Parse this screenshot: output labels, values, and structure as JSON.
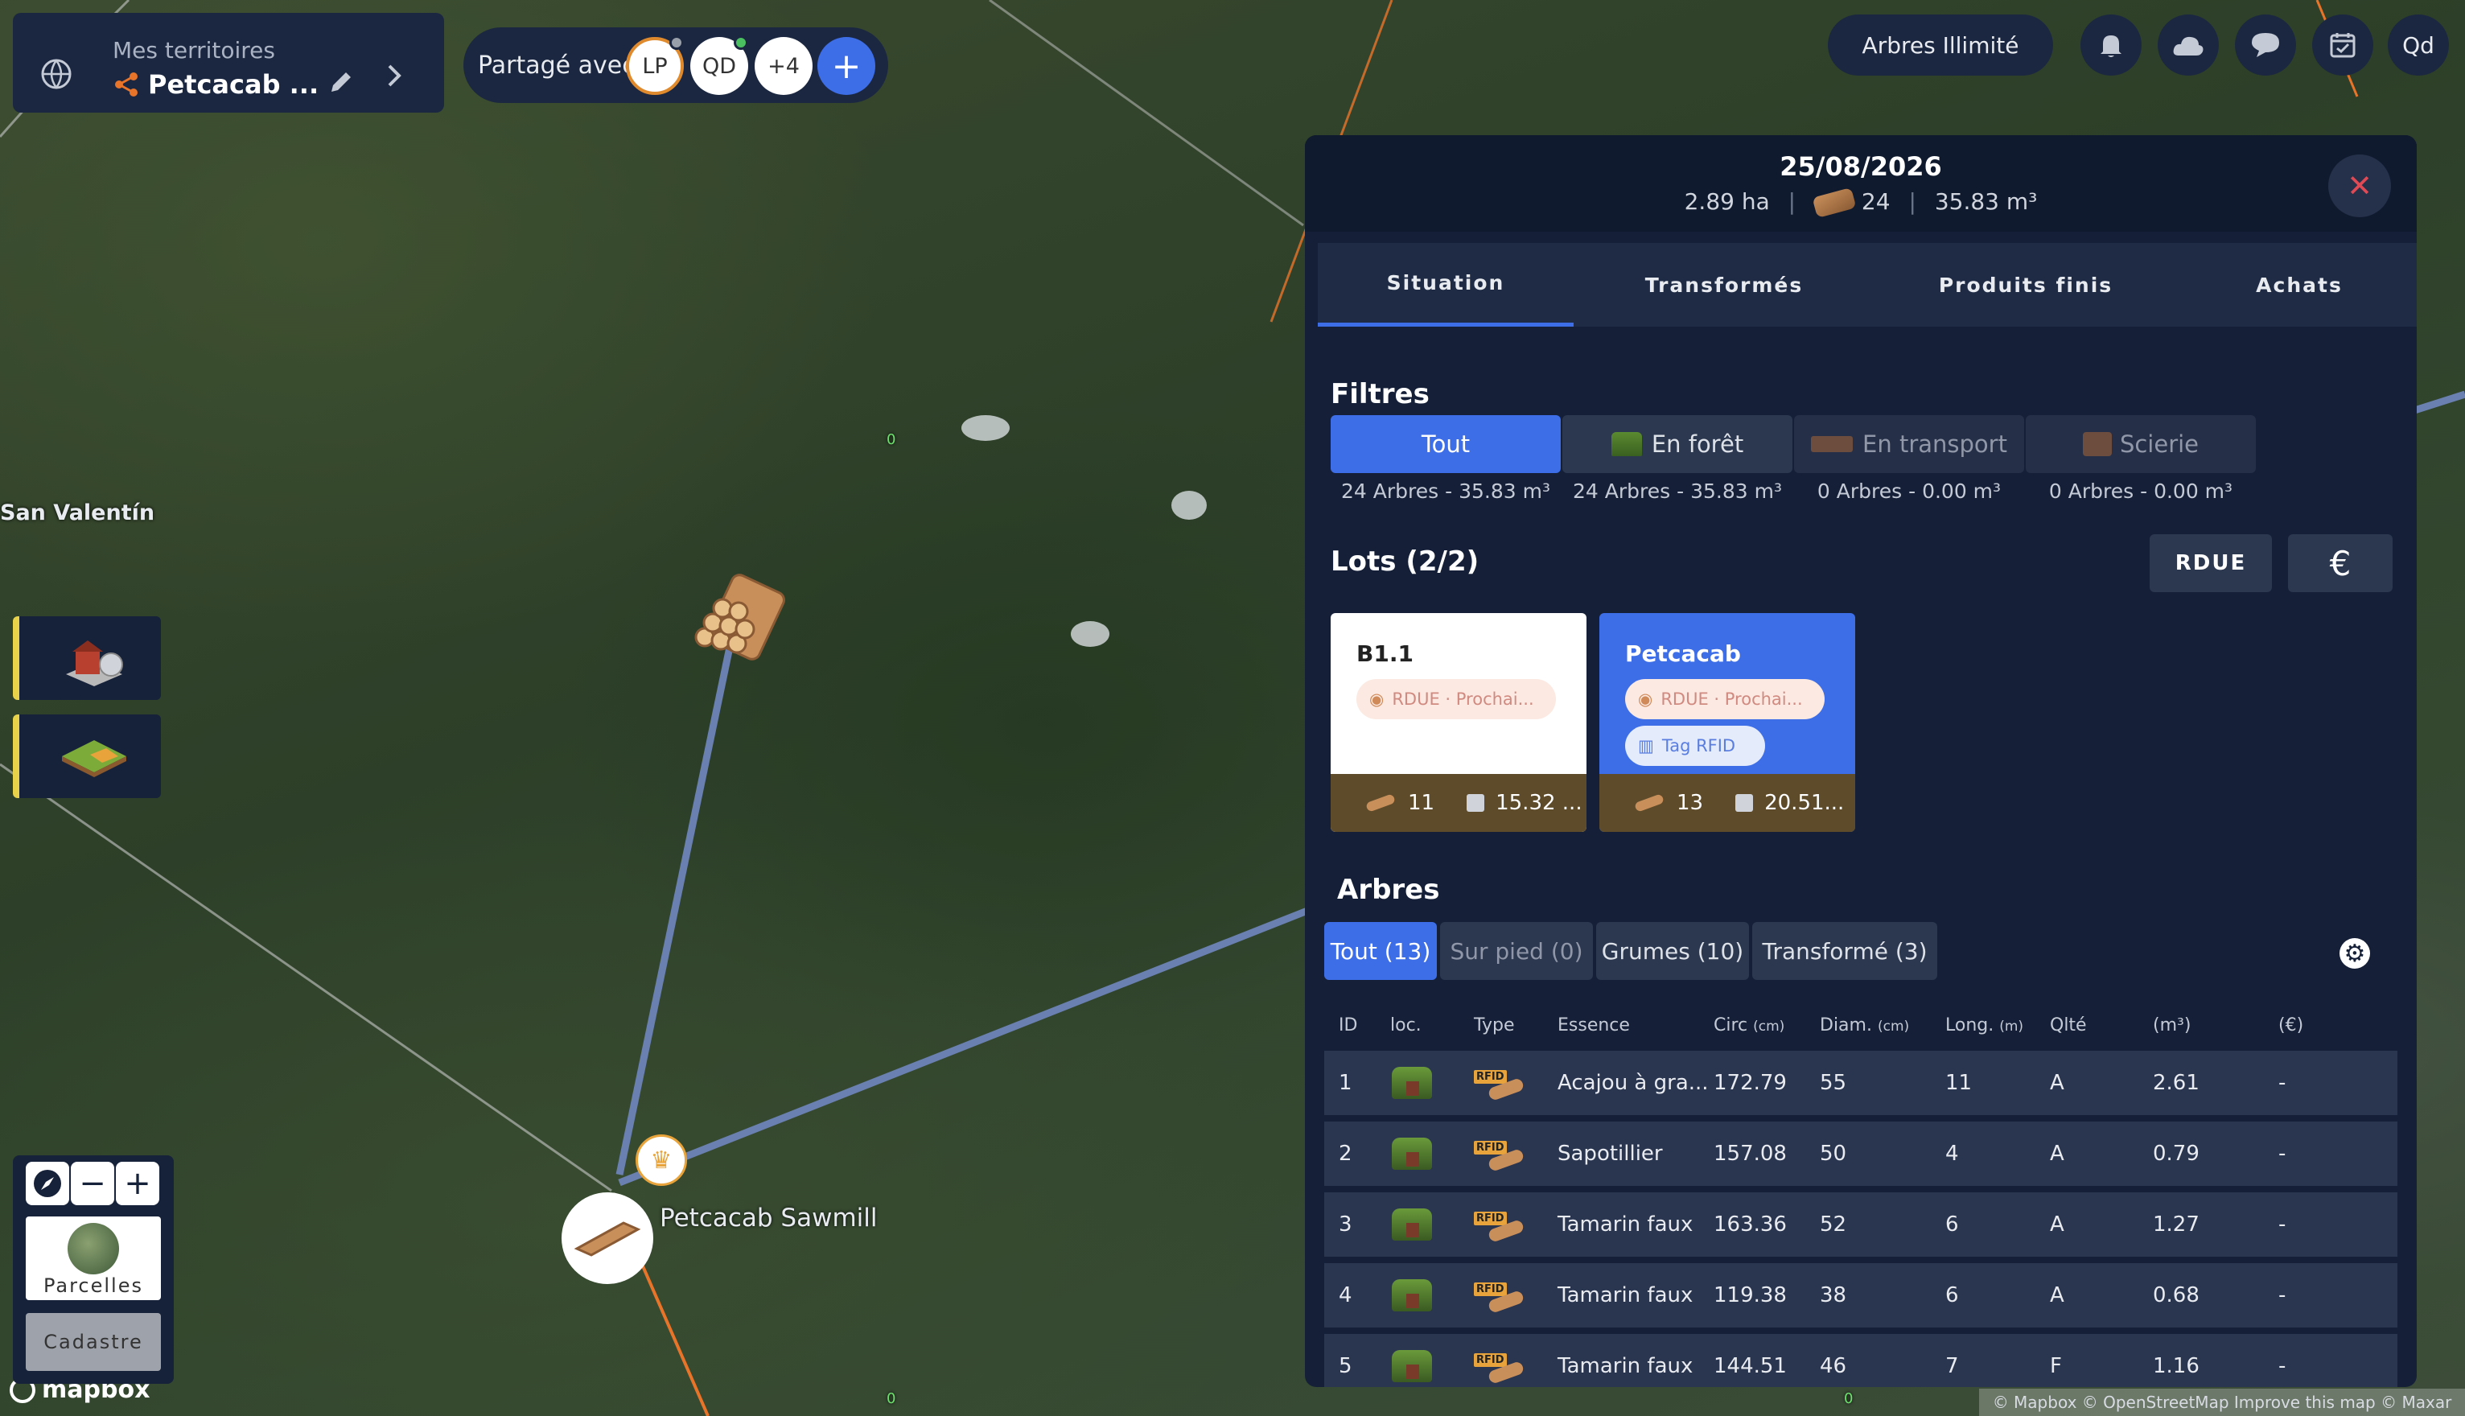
{
  "territory": {
    "label": "Mes territoires",
    "name": "Petcacab ..."
  },
  "share": {
    "label": "Partagé avec",
    "avatars": [
      "LP",
      "QD",
      "+4",
      "+"
    ]
  },
  "topbar": {
    "plan": "Arbres Illimité",
    "user": "Qd"
  },
  "map": {
    "place": "San Valentín",
    "sawmill": "Petcacab Sawmill",
    "zero1": "0",
    "zero2": "0",
    "zero3": "0",
    "logo": "mapbox",
    "attribution": "© Mapbox © OpenStreetMap Improve this map © Maxar"
  },
  "mapcontrols": {
    "parcelles": "Parcelles",
    "cadastre": "Cadastre"
  },
  "panel": {
    "date": "25/08/2026",
    "area": "2.89 ha",
    "count": "24",
    "volume": "35.83 m³",
    "tabs": [
      "Situation",
      "Transformés",
      "Produits finis",
      "Achats"
    ],
    "filters_title": "Filtres",
    "filters": [
      {
        "label": "Tout",
        "sub": "24 Arbres - 35.83 m³"
      },
      {
        "label": "En forêt",
        "sub": "24 Arbres - 35.83 m³"
      },
      {
        "label": "En transport",
        "sub": "0 Arbres - 0.00 m³"
      },
      {
        "label": "Scierie",
        "sub": "0 Arbres - 0.00 m³"
      }
    ],
    "lots_title": "Lots (2/2)",
    "rdue": "RDUE",
    "euro": "€",
    "lots": [
      {
        "name": "B1.1",
        "tag": "RDUE · Prochai...",
        "count": "11",
        "vol": "15.32 ..."
      },
      {
        "name": "Petcacab",
        "tag": "RDUE · Prochai...",
        "rfid": "Tag RFID",
        "count": "13",
        "vol": "20.51..."
      }
    ],
    "trees_title": "Arbres",
    "tree_tabs": [
      "Tout (13)",
      "Sur pied (0)",
      "Grumes (10)",
      "Transformé (3)"
    ],
    "columns": [
      "ID",
      "loc.",
      "Type",
      "Essence",
      "Circ",
      "(cm)",
      "Diam.",
      "(cm)",
      "Long.",
      "(m)",
      "Qlté",
      "(m³)",
      "(€)"
    ],
    "rows": [
      {
        "id": "1",
        "essence": "Acajou à gra...",
        "circ": "172.79",
        "diam": "55",
        "long": "11",
        "q": "A",
        "vol": "2.61",
        "eur": "-"
      },
      {
        "id": "2",
        "essence": "Sapotillier",
        "circ": "157.08",
        "diam": "50",
        "long": "4",
        "q": "A",
        "vol": "0.79",
        "eur": "-"
      },
      {
        "id": "3",
        "essence": "Tamarin faux",
        "circ": "163.36",
        "diam": "52",
        "long": "6",
        "q": "A",
        "vol": "1.27",
        "eur": "-"
      },
      {
        "id": "4",
        "essence": "Tamarin faux",
        "circ": "119.38",
        "diam": "38",
        "long": "6",
        "q": "A",
        "vol": "0.68",
        "eur": "-"
      },
      {
        "id": "5",
        "essence": "Tamarin faux",
        "circ": "144.51",
        "diam": "46",
        "long": "7",
        "q": "F",
        "vol": "1.16",
        "eur": "-"
      }
    ],
    "rfid": "RFID"
  },
  "colors": {
    "accent": "#3d6ee8",
    "panel": "#152038",
    "lot_footer": "#5e4b2a"
  }
}
